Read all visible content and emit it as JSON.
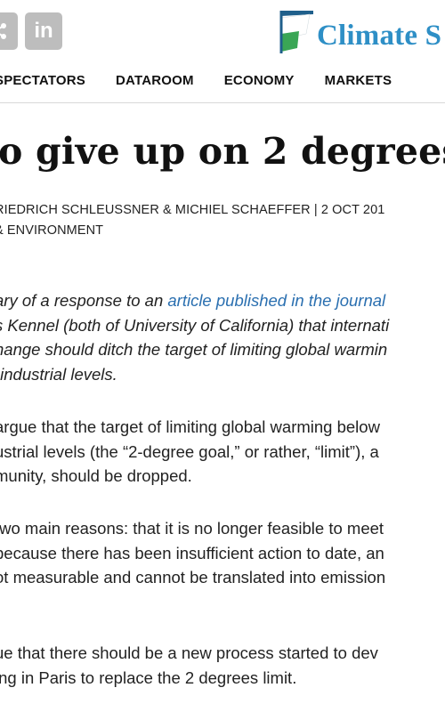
{
  "social": {
    "icons": [
      "share-icon",
      "linkedin-icon"
    ],
    "linkedin_label": "in"
  },
  "logo": {
    "text": "Climate S",
    "colors": {
      "blue": "#2e8fc6",
      "green": "#3aa655",
      "dark": "#1f5f8b"
    }
  },
  "nav": {
    "items": [
      "SPECTATORS",
      "DATAROOM",
      "ECONOMY",
      "MARKETS"
    ]
  },
  "article": {
    "headline": "o give up on 2 degrees",
    "byline": "RIEDRICH SCHLEUSSNER & MICHIEL SCHAEFFER | 2 OCT 201",
    "category": "& ENVIRONMENT",
    "intro": {
      "line1_text": "ary of a response to an ",
      "line1_link": "article published in the journal",
      "line2": "s Kennel (both of University of California) that internati",
      "line3": "hange should ditch the target of limiting global warmin",
      "line4": "-industrial levels."
    },
    "paragraphs": [
      [
        "argue that the target of limiting global warming below",
        "ustrial levels (the “2-degree goal,” or rather, “limit”), a",
        "munity, should be dropped."
      ],
      [
        "two main reasons: that it is no longer feasible to meet",
        "because there has been insufficient action to date, an",
        "ot measurable and cannot be translated into emission"
      ],
      [
        "ue that there should be a new process started to dev",
        "ing in Paris to replace the 2 degrees limit."
      ]
    ],
    "link_color": "#2a6fb0"
  }
}
